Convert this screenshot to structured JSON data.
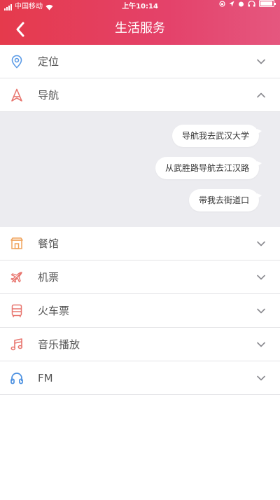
{
  "status_bar": {
    "carrier": "中国移动",
    "time": "上午10:14"
  },
  "nav": {
    "title": "生活服务"
  },
  "colors": {
    "accent": "#e43e5a",
    "location_icon": "#5b9be6",
    "category_icon": "#e8756e",
    "headphones_icon": "#4a8fe0"
  },
  "sections": [
    {
      "id": "location",
      "label": "定位",
      "icon": "location-pin-icon",
      "expanded": false
    },
    {
      "id": "navigation",
      "label": "导航",
      "icon": "navigation-arrow-icon",
      "expanded": true
    },
    {
      "id": "restaurant",
      "label": "餐馆",
      "icon": "restaurant-icon",
      "expanded": false
    },
    {
      "id": "flight",
      "label": "机票",
      "icon": "airplane-icon",
      "expanded": false
    },
    {
      "id": "train",
      "label": "火车票",
      "icon": "train-icon",
      "expanded": false
    },
    {
      "id": "music",
      "label": "音乐播放",
      "icon": "music-note-icon",
      "expanded": false
    },
    {
      "id": "fm",
      "label": "FM",
      "icon": "headphones-icon",
      "expanded": false
    }
  ],
  "navigation_examples": [
    "导航我去武汉大学",
    "从武胜路导航去江汉路",
    "带我去街道口"
  ]
}
